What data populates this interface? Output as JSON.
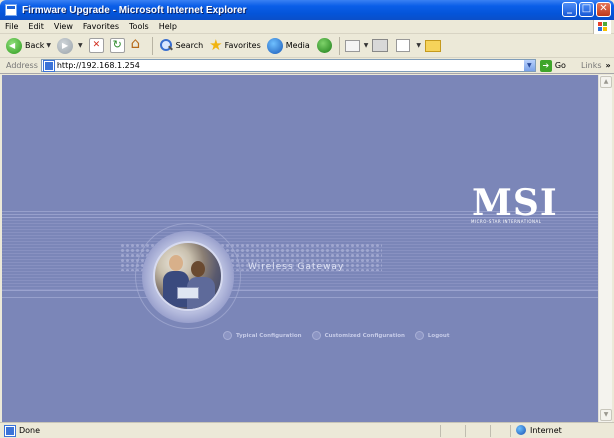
{
  "window": {
    "title": "Firmware Upgrade - Microsoft Internet Explorer",
    "controls": [
      "_",
      "□",
      "✕"
    ]
  },
  "menu": {
    "items": [
      "File",
      "Edit",
      "View",
      "Favorites",
      "Tools",
      "Help"
    ]
  },
  "toolbar": {
    "back_label": "Back",
    "search_label": "Search",
    "favorites_label": "Favorites",
    "media_label": "Media"
  },
  "address": {
    "label": "Address",
    "url": "http://192.168.1.254",
    "go_label": "Go",
    "links_label": "Links",
    "chevron": "»"
  },
  "page": {
    "logo": "MSI",
    "logo_subtitle": "MICRO-STAR INTERNATIONAL",
    "product_name": "Wireless Gateway",
    "nav": [
      "Typical Configuration",
      "Customized Configuration",
      "Logout"
    ]
  },
  "status": {
    "text": "Done",
    "zone": "Internet"
  },
  "colors": {
    "content_bg": "#7b86b8",
    "titlebar": "#0a5ee8"
  }
}
